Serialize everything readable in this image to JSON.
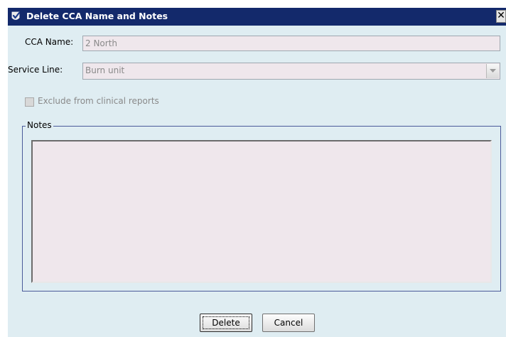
{
  "window": {
    "title": "Delete CCA Name and Notes",
    "close_glyph": "✕"
  },
  "form": {
    "cca_name_label": "CCA Name:",
    "cca_name_value": "2 North",
    "service_line_label": "Service Line:",
    "service_line_value": "Burn unit",
    "exclude_label": "Exclude from clinical reports",
    "exclude_checked": false,
    "notes_legend": "Notes",
    "notes_value": ""
  },
  "buttons": {
    "delete_label": "Delete",
    "cancel_label": "Cancel"
  },
  "icons": {
    "title_icon": "check-shield-icon",
    "combo_arrow": "chevron-down-icon"
  },
  "colors": {
    "titlebar": "#13296b",
    "dialog_body": "#dfedf2",
    "field_bg": "#efe7ec",
    "disabled_text": "#8a8a8a",
    "group_border": "#4a5a9a"
  }
}
